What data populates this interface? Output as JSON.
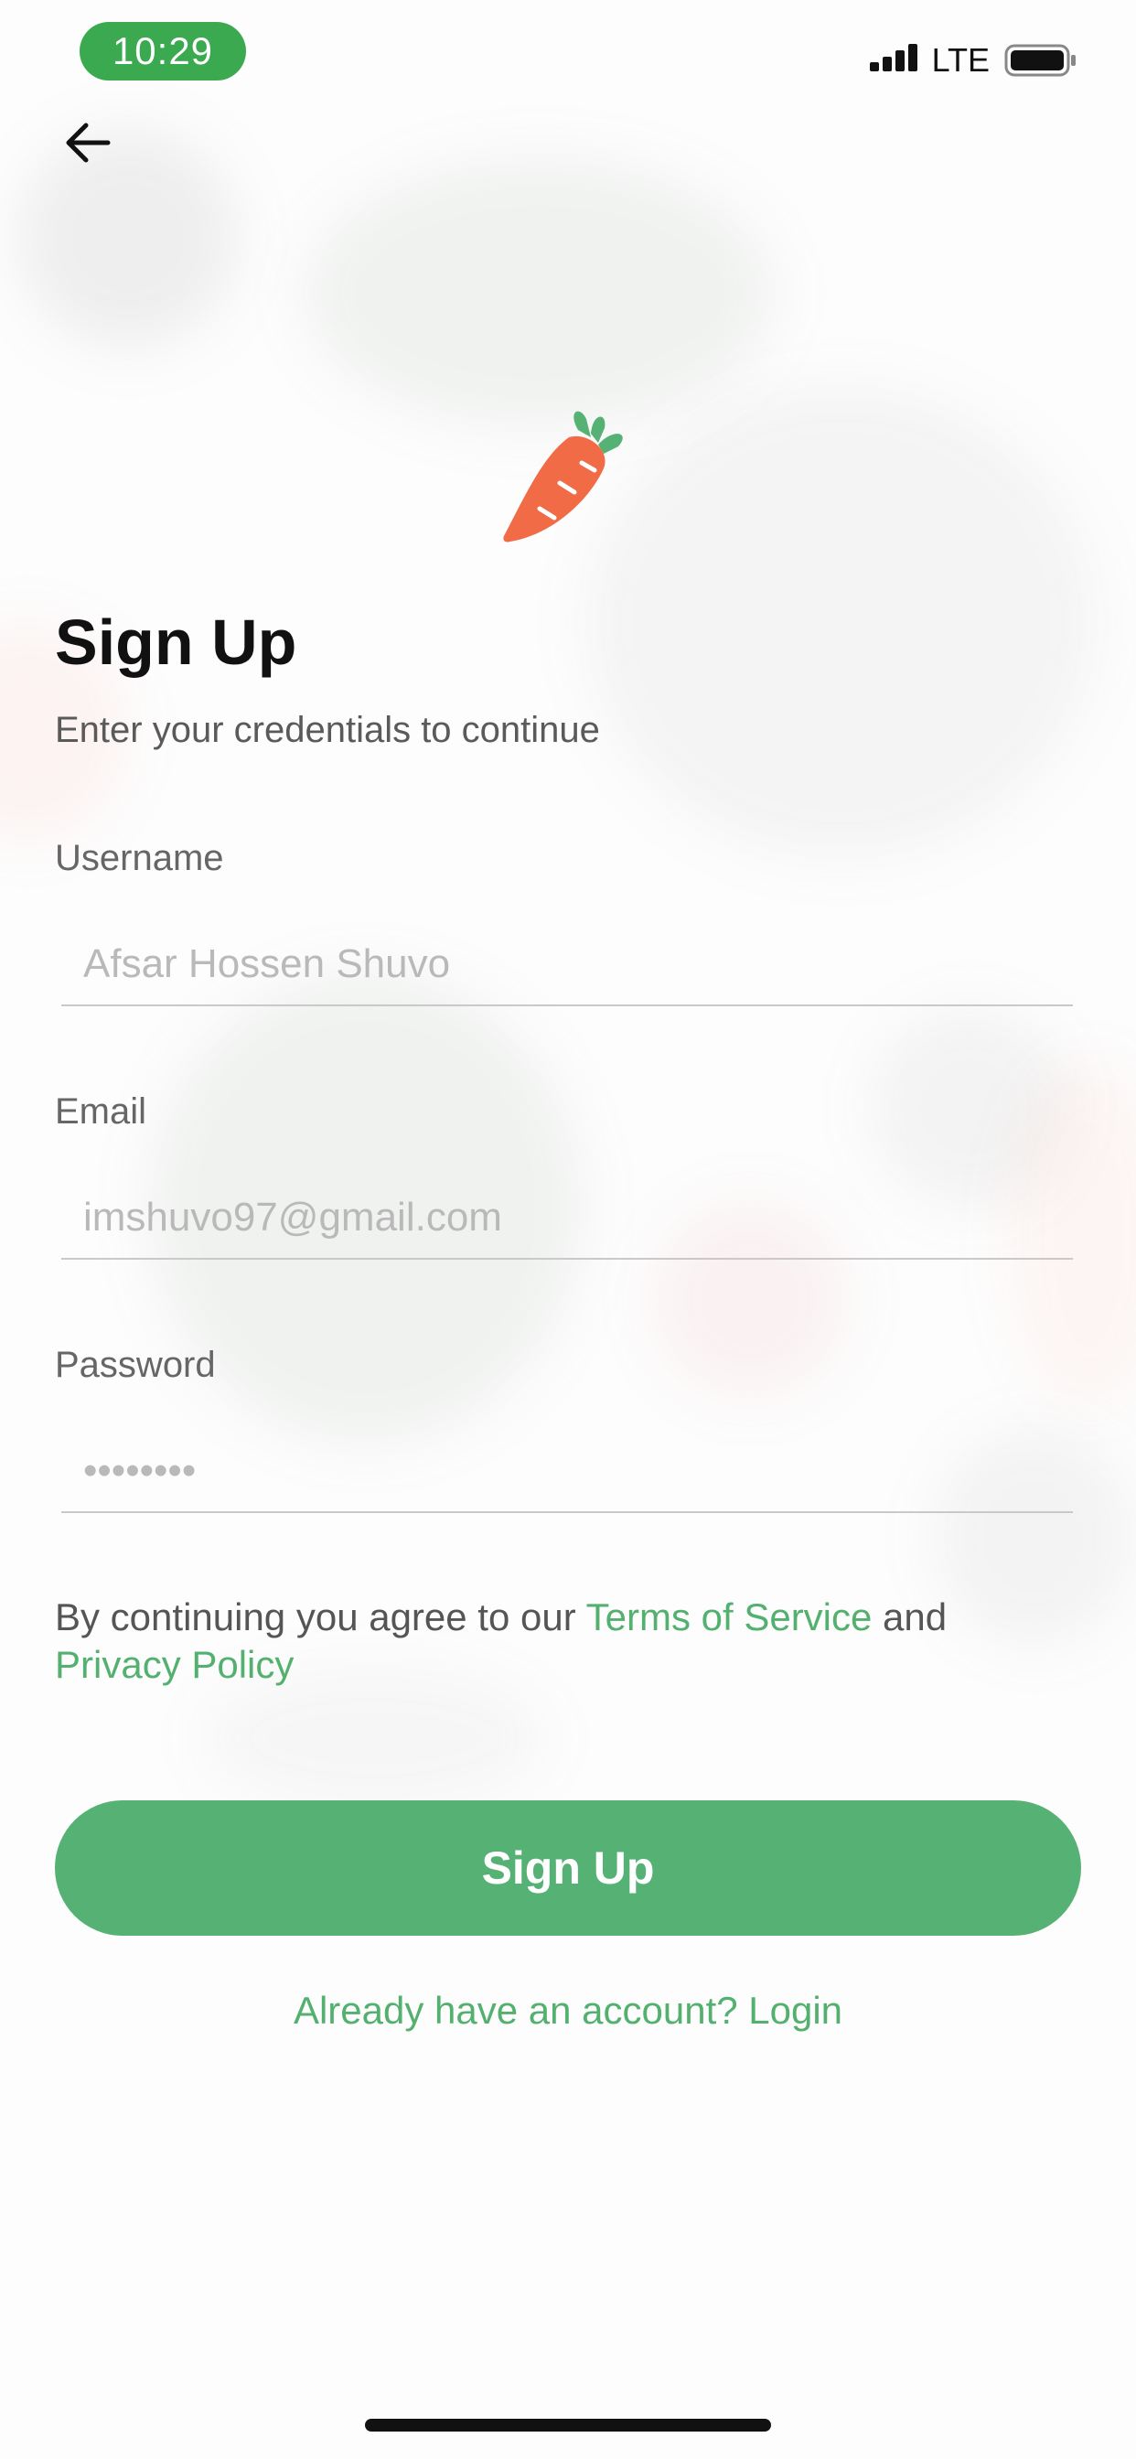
{
  "status_bar": {
    "time": "10:29",
    "network": "LTE",
    "icons": [
      "signal-icon",
      "battery-icon"
    ]
  },
  "header": {
    "back_icon": "arrow-left-icon",
    "logo_icon": "carrot-icon"
  },
  "main": {
    "title": "Sign Up",
    "subtitle": "Enter your credentials to continue",
    "fields": {
      "username": {
        "label": "Username",
        "placeholder": "Afsar Hossen Shuvo",
        "value": ""
      },
      "email": {
        "label": "Email",
        "placeholder": "imshuvo97@gmail.com",
        "value": ""
      },
      "password": {
        "label": "Password",
        "placeholder": "••••••••",
        "value": ""
      }
    },
    "terms": {
      "prefix": "By continuing you agree to our ",
      "terms_link": "Terms of Service",
      "middle": " and ",
      "privacy_link": "Privacy Policy"
    },
    "signup_button_label": "Sign Up",
    "login_link": "Already have an account? Login"
  },
  "colors": {
    "accent": "#56b274",
    "time_pill": "#3aa94f",
    "carrot_body": "#f26b47",
    "carrot_leaves": "#56b274"
  }
}
